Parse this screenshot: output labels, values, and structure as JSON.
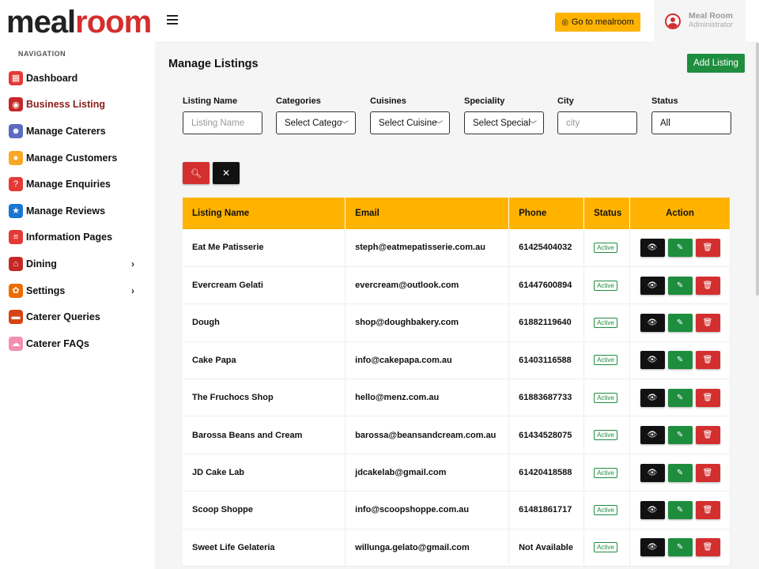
{
  "logo": {
    "part1": "meal",
    "part2": "room"
  },
  "nav": {
    "heading": "NAVIGATION",
    "items": [
      {
        "label": "Dashboard",
        "icon": "dashboard-icon",
        "color": "#e53935",
        "glyph": "▦",
        "chevron": false,
        "active": false
      },
      {
        "label": "Business Listing",
        "icon": "business-listing-icon",
        "color": "#c62828",
        "glyph": "◉",
        "chevron": false,
        "active": true
      },
      {
        "label": "Manage Caterers",
        "icon": "caterer-icon",
        "color": "#5c6bc0",
        "glyph": "☻",
        "chevron": false,
        "active": false
      },
      {
        "label": "Manage Customers",
        "icon": "customer-icon",
        "color": "#f9a825",
        "glyph": "●",
        "chevron": false,
        "active": false
      },
      {
        "label": "Manage Enquiries",
        "icon": "enquiry-icon",
        "color": "#e53935",
        "glyph": "?",
        "chevron": false,
        "active": false
      },
      {
        "label": "Manage Reviews",
        "icon": "review-icon",
        "color": "#1976d2",
        "glyph": "★",
        "chevron": false,
        "active": false
      },
      {
        "label": "Information Pages",
        "icon": "info-pages-icon",
        "color": "#e53935",
        "glyph": "≡",
        "chevron": false,
        "active": false
      },
      {
        "label": "Dining",
        "icon": "dining-icon",
        "color": "#c62828",
        "glyph": "⌂",
        "chevron": true,
        "active": false
      },
      {
        "label": "Settings",
        "icon": "settings-icon",
        "color": "#ef6c00",
        "glyph": "✿",
        "chevron": true,
        "active": false
      },
      {
        "label": "Caterer Queries",
        "icon": "queries-icon",
        "color": "#d84315",
        "glyph": "▬",
        "chevron": false,
        "active": false
      },
      {
        "label": "Caterer FAQs",
        "icon": "faq-icon",
        "color": "#f48fb1",
        "glyph": "☁",
        "chevron": false,
        "active": false
      }
    ]
  },
  "header": {
    "goto_label": "Go to mealroom",
    "user_name": "Meal Room",
    "user_role": "Administrator"
  },
  "page": {
    "title": "Manage Listings",
    "add_label": "Add Listing"
  },
  "filters": {
    "listing_name": {
      "label": "Listing Name",
      "placeholder": "Listing Name"
    },
    "categories": {
      "label": "Categories",
      "value": "Select Catego"
    },
    "cuisines": {
      "label": "Cuisines",
      "value": "Select Cuisine"
    },
    "speciality": {
      "label": "Speciality",
      "value": "Select Special"
    },
    "city": {
      "label": "City",
      "placeholder": "city"
    },
    "status": {
      "label": "Status",
      "value": "All"
    }
  },
  "table": {
    "headers": {
      "name": "Listing Name",
      "email": "Email",
      "phone": "Phone",
      "status": "Status",
      "action": "Action"
    },
    "rows": [
      {
        "name": "Eat Me Patisserie",
        "email": "steph@eatmepatisserie.com.au",
        "phone": "61425404032",
        "status": "Active"
      },
      {
        "name": "Evercream Gelati",
        "email": "evercream@outlook.com",
        "phone": "61447600894",
        "status": "Active"
      },
      {
        "name": "Dough",
        "email": "shop@doughbakery.com",
        "phone": "61882119640",
        "status": "Active"
      },
      {
        "name": "Cake Papa",
        "email": "info@cakepapa.com.au",
        "phone": "61403116588",
        "status": "Active"
      },
      {
        "name": "The Fruchocs Shop",
        "email": "hello@menz.com.au",
        "phone": "61883687733",
        "status": "Active"
      },
      {
        "name": "Barossa Beans and Cream",
        "email": "barossa@beansandcream.com.au",
        "phone": "61434528075",
        "status": "Active"
      },
      {
        "name": "JD Cake Lab",
        "email": "jdcakelab@gmail.com",
        "phone": "61420418588",
        "status": "Active"
      },
      {
        "name": "Scoop Shoppe",
        "email": "info@scoopshoppe.com.au",
        "phone": "61481861717",
        "status": "Active"
      },
      {
        "name": "Sweet Life Gelateria",
        "email": "willunga.gelato@gmail.com",
        "phone": "Not Available",
        "status": "Active"
      }
    ]
  }
}
